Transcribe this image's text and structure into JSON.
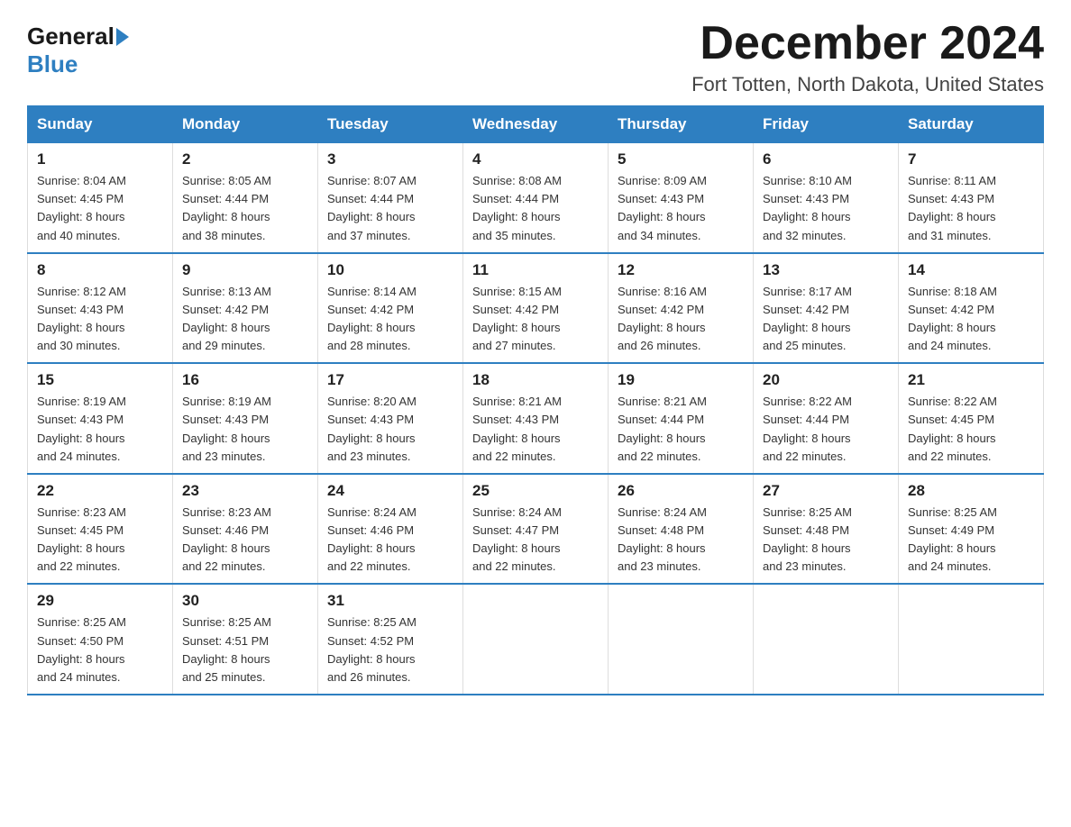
{
  "logo": {
    "general": "General",
    "blue": "Blue"
  },
  "title": "December 2024",
  "location": "Fort Totten, North Dakota, United States",
  "weekdays": [
    "Sunday",
    "Monday",
    "Tuesday",
    "Wednesday",
    "Thursday",
    "Friday",
    "Saturday"
  ],
  "weeks": [
    [
      {
        "day": "1",
        "sunrise": "8:04 AM",
        "sunset": "4:45 PM",
        "daylight": "8 hours and 40 minutes."
      },
      {
        "day": "2",
        "sunrise": "8:05 AM",
        "sunset": "4:44 PM",
        "daylight": "8 hours and 38 minutes."
      },
      {
        "day": "3",
        "sunrise": "8:07 AM",
        "sunset": "4:44 PM",
        "daylight": "8 hours and 37 minutes."
      },
      {
        "day": "4",
        "sunrise": "8:08 AM",
        "sunset": "4:44 PM",
        "daylight": "8 hours and 35 minutes."
      },
      {
        "day": "5",
        "sunrise": "8:09 AM",
        "sunset": "4:43 PM",
        "daylight": "8 hours and 34 minutes."
      },
      {
        "day": "6",
        "sunrise": "8:10 AM",
        "sunset": "4:43 PM",
        "daylight": "8 hours and 32 minutes."
      },
      {
        "day": "7",
        "sunrise": "8:11 AM",
        "sunset": "4:43 PM",
        "daylight": "8 hours and 31 minutes."
      }
    ],
    [
      {
        "day": "8",
        "sunrise": "8:12 AM",
        "sunset": "4:43 PM",
        "daylight": "8 hours and 30 minutes."
      },
      {
        "day": "9",
        "sunrise": "8:13 AM",
        "sunset": "4:42 PM",
        "daylight": "8 hours and 29 minutes."
      },
      {
        "day": "10",
        "sunrise": "8:14 AM",
        "sunset": "4:42 PM",
        "daylight": "8 hours and 28 minutes."
      },
      {
        "day": "11",
        "sunrise": "8:15 AM",
        "sunset": "4:42 PM",
        "daylight": "8 hours and 27 minutes."
      },
      {
        "day": "12",
        "sunrise": "8:16 AM",
        "sunset": "4:42 PM",
        "daylight": "8 hours and 26 minutes."
      },
      {
        "day": "13",
        "sunrise": "8:17 AM",
        "sunset": "4:42 PM",
        "daylight": "8 hours and 25 minutes."
      },
      {
        "day": "14",
        "sunrise": "8:18 AM",
        "sunset": "4:42 PM",
        "daylight": "8 hours and 24 minutes."
      }
    ],
    [
      {
        "day": "15",
        "sunrise": "8:19 AM",
        "sunset": "4:43 PM",
        "daylight": "8 hours and 24 minutes."
      },
      {
        "day": "16",
        "sunrise": "8:19 AM",
        "sunset": "4:43 PM",
        "daylight": "8 hours and 23 minutes."
      },
      {
        "day": "17",
        "sunrise": "8:20 AM",
        "sunset": "4:43 PM",
        "daylight": "8 hours and 23 minutes."
      },
      {
        "day": "18",
        "sunrise": "8:21 AM",
        "sunset": "4:43 PM",
        "daylight": "8 hours and 22 minutes."
      },
      {
        "day": "19",
        "sunrise": "8:21 AM",
        "sunset": "4:44 PM",
        "daylight": "8 hours and 22 minutes."
      },
      {
        "day": "20",
        "sunrise": "8:22 AM",
        "sunset": "4:44 PM",
        "daylight": "8 hours and 22 minutes."
      },
      {
        "day": "21",
        "sunrise": "8:22 AM",
        "sunset": "4:45 PM",
        "daylight": "8 hours and 22 minutes."
      }
    ],
    [
      {
        "day": "22",
        "sunrise": "8:23 AM",
        "sunset": "4:45 PM",
        "daylight": "8 hours and 22 minutes."
      },
      {
        "day": "23",
        "sunrise": "8:23 AM",
        "sunset": "4:46 PM",
        "daylight": "8 hours and 22 minutes."
      },
      {
        "day": "24",
        "sunrise": "8:24 AM",
        "sunset": "4:46 PM",
        "daylight": "8 hours and 22 minutes."
      },
      {
        "day": "25",
        "sunrise": "8:24 AM",
        "sunset": "4:47 PM",
        "daylight": "8 hours and 22 minutes."
      },
      {
        "day": "26",
        "sunrise": "8:24 AM",
        "sunset": "4:48 PM",
        "daylight": "8 hours and 23 minutes."
      },
      {
        "day": "27",
        "sunrise": "8:25 AM",
        "sunset": "4:48 PM",
        "daylight": "8 hours and 23 minutes."
      },
      {
        "day": "28",
        "sunrise": "8:25 AM",
        "sunset": "4:49 PM",
        "daylight": "8 hours and 24 minutes."
      }
    ],
    [
      {
        "day": "29",
        "sunrise": "8:25 AM",
        "sunset": "4:50 PM",
        "daylight": "8 hours and 24 minutes."
      },
      {
        "day": "30",
        "sunrise": "8:25 AM",
        "sunset": "4:51 PM",
        "daylight": "8 hours and 25 minutes."
      },
      {
        "day": "31",
        "sunrise": "8:25 AM",
        "sunset": "4:52 PM",
        "daylight": "8 hours and 26 minutes."
      },
      null,
      null,
      null,
      null
    ]
  ],
  "labels": {
    "sunrise": "Sunrise:",
    "sunset": "Sunset:",
    "daylight": "Daylight:"
  }
}
